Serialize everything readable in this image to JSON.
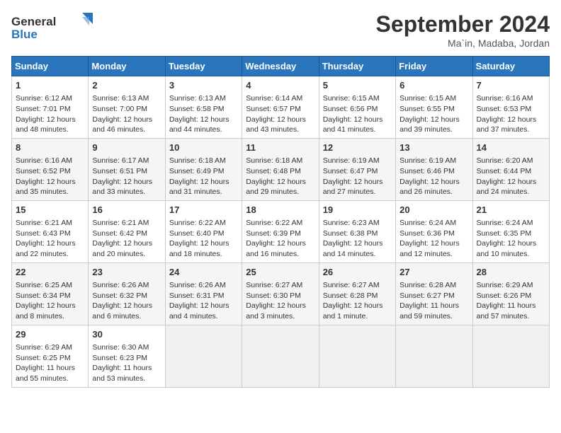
{
  "header": {
    "logo_line1": "General",
    "logo_line2": "Blue",
    "month": "September 2024",
    "location": "Ma`in, Madaba, Jordan"
  },
  "weekdays": [
    "Sunday",
    "Monday",
    "Tuesday",
    "Wednesday",
    "Thursday",
    "Friday",
    "Saturday"
  ],
  "weeks": [
    [
      {
        "day": "1",
        "info": "Sunrise: 6:12 AM\nSunset: 7:01 PM\nDaylight: 12 hours\nand 48 minutes."
      },
      {
        "day": "2",
        "info": "Sunrise: 6:13 AM\nSunset: 7:00 PM\nDaylight: 12 hours\nand 46 minutes."
      },
      {
        "day": "3",
        "info": "Sunrise: 6:13 AM\nSunset: 6:58 PM\nDaylight: 12 hours\nand 44 minutes."
      },
      {
        "day": "4",
        "info": "Sunrise: 6:14 AM\nSunset: 6:57 PM\nDaylight: 12 hours\nand 43 minutes."
      },
      {
        "day": "5",
        "info": "Sunrise: 6:15 AM\nSunset: 6:56 PM\nDaylight: 12 hours\nand 41 minutes."
      },
      {
        "day": "6",
        "info": "Sunrise: 6:15 AM\nSunset: 6:55 PM\nDaylight: 12 hours\nand 39 minutes."
      },
      {
        "day": "7",
        "info": "Sunrise: 6:16 AM\nSunset: 6:53 PM\nDaylight: 12 hours\nand 37 minutes."
      }
    ],
    [
      {
        "day": "8",
        "info": "Sunrise: 6:16 AM\nSunset: 6:52 PM\nDaylight: 12 hours\nand 35 minutes."
      },
      {
        "day": "9",
        "info": "Sunrise: 6:17 AM\nSunset: 6:51 PM\nDaylight: 12 hours\nand 33 minutes."
      },
      {
        "day": "10",
        "info": "Sunrise: 6:18 AM\nSunset: 6:49 PM\nDaylight: 12 hours\nand 31 minutes."
      },
      {
        "day": "11",
        "info": "Sunrise: 6:18 AM\nSunset: 6:48 PM\nDaylight: 12 hours\nand 29 minutes."
      },
      {
        "day": "12",
        "info": "Sunrise: 6:19 AM\nSunset: 6:47 PM\nDaylight: 12 hours\nand 27 minutes."
      },
      {
        "day": "13",
        "info": "Sunrise: 6:19 AM\nSunset: 6:46 PM\nDaylight: 12 hours\nand 26 minutes."
      },
      {
        "day": "14",
        "info": "Sunrise: 6:20 AM\nSunset: 6:44 PM\nDaylight: 12 hours\nand 24 minutes."
      }
    ],
    [
      {
        "day": "15",
        "info": "Sunrise: 6:21 AM\nSunset: 6:43 PM\nDaylight: 12 hours\nand 22 minutes."
      },
      {
        "day": "16",
        "info": "Sunrise: 6:21 AM\nSunset: 6:42 PM\nDaylight: 12 hours\nand 20 minutes."
      },
      {
        "day": "17",
        "info": "Sunrise: 6:22 AM\nSunset: 6:40 PM\nDaylight: 12 hours\nand 18 minutes."
      },
      {
        "day": "18",
        "info": "Sunrise: 6:22 AM\nSunset: 6:39 PM\nDaylight: 12 hours\nand 16 minutes."
      },
      {
        "day": "19",
        "info": "Sunrise: 6:23 AM\nSunset: 6:38 PM\nDaylight: 12 hours\nand 14 minutes."
      },
      {
        "day": "20",
        "info": "Sunrise: 6:24 AM\nSunset: 6:36 PM\nDaylight: 12 hours\nand 12 minutes."
      },
      {
        "day": "21",
        "info": "Sunrise: 6:24 AM\nSunset: 6:35 PM\nDaylight: 12 hours\nand 10 minutes."
      }
    ],
    [
      {
        "day": "22",
        "info": "Sunrise: 6:25 AM\nSunset: 6:34 PM\nDaylight: 12 hours\nand 8 minutes."
      },
      {
        "day": "23",
        "info": "Sunrise: 6:26 AM\nSunset: 6:32 PM\nDaylight: 12 hours\nand 6 minutes."
      },
      {
        "day": "24",
        "info": "Sunrise: 6:26 AM\nSunset: 6:31 PM\nDaylight: 12 hours\nand 4 minutes."
      },
      {
        "day": "25",
        "info": "Sunrise: 6:27 AM\nSunset: 6:30 PM\nDaylight: 12 hours\nand 3 minutes."
      },
      {
        "day": "26",
        "info": "Sunrise: 6:27 AM\nSunset: 6:28 PM\nDaylight: 12 hours\nand 1 minute."
      },
      {
        "day": "27",
        "info": "Sunrise: 6:28 AM\nSunset: 6:27 PM\nDaylight: 11 hours\nand 59 minutes."
      },
      {
        "day": "28",
        "info": "Sunrise: 6:29 AM\nSunset: 6:26 PM\nDaylight: 11 hours\nand 57 minutes."
      }
    ],
    [
      {
        "day": "29",
        "info": "Sunrise: 6:29 AM\nSunset: 6:25 PM\nDaylight: 11 hours\nand 55 minutes."
      },
      {
        "day": "30",
        "info": "Sunrise: 6:30 AM\nSunset: 6:23 PM\nDaylight: 11 hours\nand 53 minutes."
      },
      {
        "day": "",
        "info": ""
      },
      {
        "day": "",
        "info": ""
      },
      {
        "day": "",
        "info": ""
      },
      {
        "day": "",
        "info": ""
      },
      {
        "day": "",
        "info": ""
      }
    ]
  ]
}
